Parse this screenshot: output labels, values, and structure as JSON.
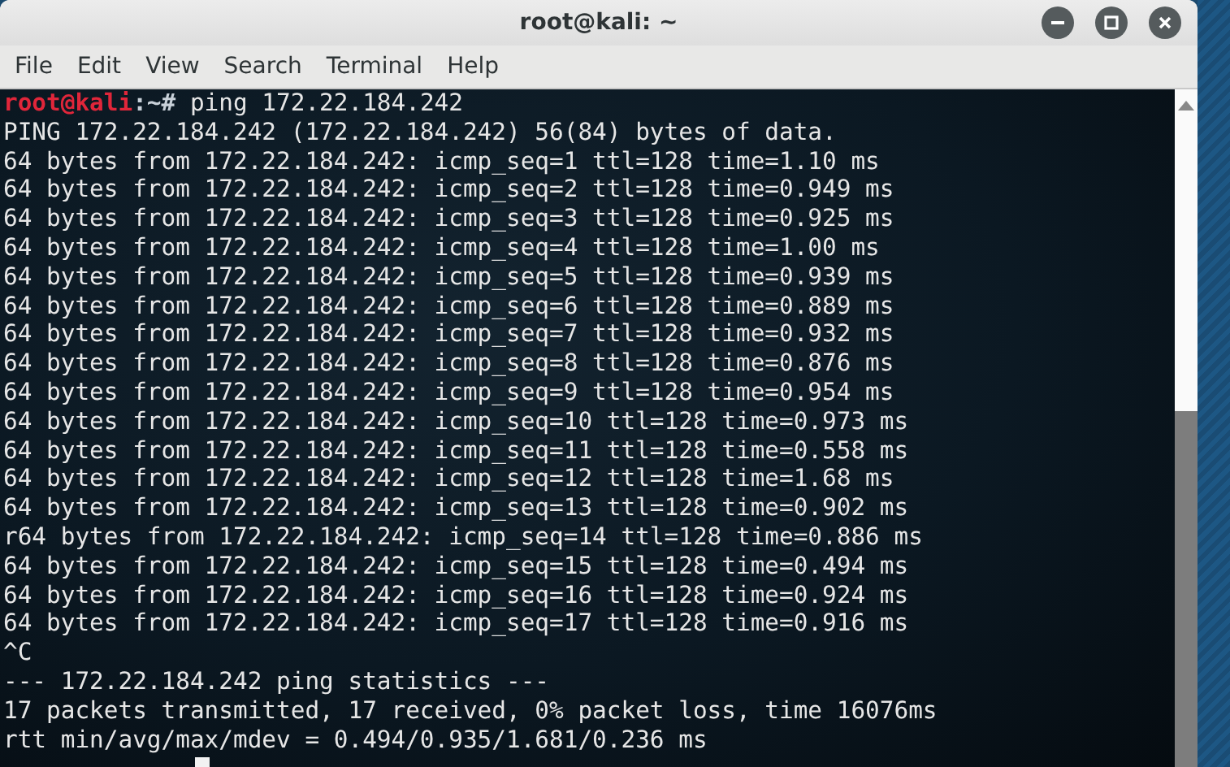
{
  "window": {
    "title": "root@kali: ~"
  },
  "menu": [
    "File",
    "Edit",
    "View",
    "Search",
    "Terminal",
    "Help"
  ],
  "terminal": {
    "prompt": {
      "user": "root@kali",
      "path": ":~#",
      "command": "ping 172.22.184.242"
    },
    "lines": [
      "PING 172.22.184.242 (172.22.184.242) 56(84) bytes of data.",
      "64 bytes from 172.22.184.242: icmp_seq=1 ttl=128 time=1.10 ms",
      "64 bytes from 172.22.184.242: icmp_seq=2 ttl=128 time=0.949 ms",
      "64 bytes from 172.22.184.242: icmp_seq=3 ttl=128 time=0.925 ms",
      "64 bytes from 172.22.184.242: icmp_seq=4 ttl=128 time=1.00 ms",
      "64 bytes from 172.22.184.242: icmp_seq=5 ttl=128 time=0.939 ms",
      "64 bytes from 172.22.184.242: icmp_seq=6 ttl=128 time=0.889 ms",
      "64 bytes from 172.22.184.242: icmp_seq=7 ttl=128 time=0.932 ms",
      "64 bytes from 172.22.184.242: icmp_seq=8 ttl=128 time=0.876 ms",
      "64 bytes from 172.22.184.242: icmp_seq=9 ttl=128 time=0.954 ms",
      "64 bytes from 172.22.184.242: icmp_seq=10 ttl=128 time=0.973 ms",
      "64 bytes from 172.22.184.242: icmp_seq=11 ttl=128 time=0.558 ms",
      "64 bytes from 172.22.184.242: icmp_seq=12 ttl=128 time=1.68 ms",
      "64 bytes from 172.22.184.242: icmp_seq=13 ttl=128 time=0.902 ms",
      "r64 bytes from 172.22.184.242: icmp_seq=14 ttl=128 time=0.886 ms",
      "64 bytes from 172.22.184.242: icmp_seq=15 ttl=128 time=0.494 ms",
      "64 bytes from 172.22.184.242: icmp_seq=16 ttl=128 time=0.924 ms",
      "64 bytes from 172.22.184.242: icmp_seq=17 ttl=128 time=0.916 ms",
      "^C",
      "--- 172.22.184.242 ping statistics ---",
      "17 packets transmitted, 17 received, 0% packet loss, time 16076ms",
      "rtt min/avg/max/mdev = 0.494/0.935/1.681/0.236 ms"
    ],
    "cursor": true
  }
}
